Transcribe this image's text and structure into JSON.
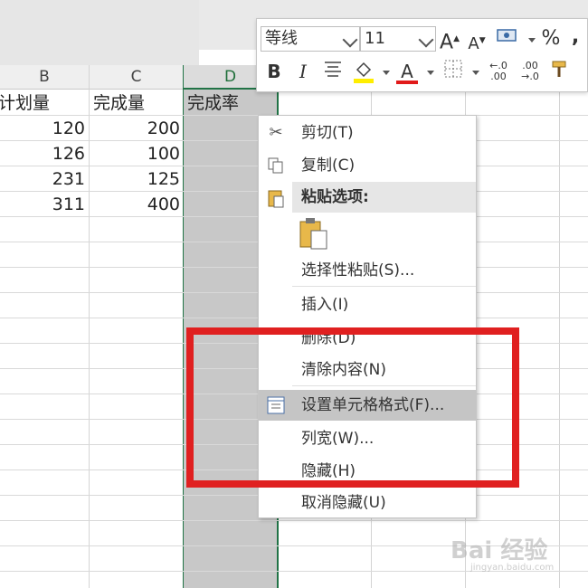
{
  "columns": {
    "b": "B",
    "c": "C",
    "d": "D"
  },
  "headers": {
    "plan": "计划量",
    "done": "完成量",
    "rate": "完成率"
  },
  "rows": [
    {
      "plan": "120",
      "done": "200"
    },
    {
      "plan": "126",
      "done": "100"
    },
    {
      "plan": "231",
      "done": "125"
    },
    {
      "plan": "311",
      "done": "400"
    }
  ],
  "mini_toolbar": {
    "font_name": "等线",
    "font_size": "11",
    "grow_font": "A",
    "shrink_font": "A",
    "percent": "%",
    "comma": ",",
    "bold": "B",
    "italic": "I",
    "font_color_letter": "A",
    "inc_decimal_top": "←.0",
    "inc_decimal_bottom": ".00",
    "dec_decimal_top": ".00",
    "dec_decimal_bottom": "→.0",
    "fill_color": "#ffee00",
    "font_color": "#e11a1a"
  },
  "context_menu": {
    "cut": "剪切(T)",
    "copy": "复制(C)",
    "paste_options": "粘贴选项:",
    "paste_special": "选择性粘贴(S)...",
    "insert": "插入(I)",
    "delete": "删除(D)",
    "clear": "清除内容(N)",
    "format_cells": "设置单元格格式(F)...",
    "col_width": "列宽(W)...",
    "hide": "隐藏(H)",
    "unhide": "取消隐藏(U)"
  },
  "watermark": {
    "main": "Bai 经验",
    "sub": "jingyan.baidu.com"
  },
  "highlight_color": "#e02020"
}
